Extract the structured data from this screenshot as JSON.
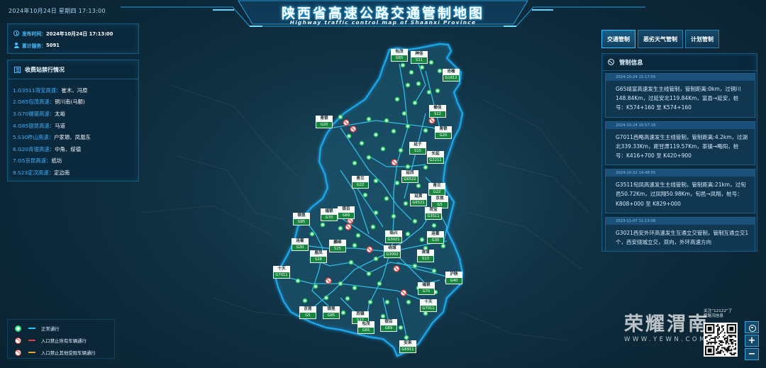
{
  "header": {
    "datetime": "2024年10月24日 星期四 17:13:00",
    "title": "陕西省高速公路交通管制地图",
    "subtitle": "Highway traffic control map of Shaanxi Province"
  },
  "info": {
    "publish_label": "发布时间：",
    "publish_value": "2024年10月24日 17:13:00",
    "service_label": "累计服务：",
    "service_value": "5091"
  },
  "stations": {
    "title": "收费站禁行情况",
    "items": [
      {
        "road": "1.G3511菏宝高速：",
        "stations": "崔木、冯原"
      },
      {
        "road": "2.G65包茂高速：",
        "stations": "铜川南(马额)"
      },
      {
        "road": "3.G70福银高速：",
        "stations": "太峪"
      },
      {
        "road": "4.G85银昆高速：",
        "stations": "马道"
      },
      {
        "road": "5.S30祚山高速：",
        "stations": "户家塬、凤凰东"
      },
      {
        "road": "6.G20青银高速：",
        "stations": "中角、绥德"
      },
      {
        "road": "7.G5京昆高速：",
        "stations": "纸坊"
      },
      {
        "road": "8.S23定汉高速：",
        "stations": "定边南"
      }
    ]
  },
  "tabs": [
    {
      "label": "交通管制"
    },
    {
      "label": "恶劣天气管制"
    },
    {
      "label": "计划管制"
    }
  ],
  "control_info": {
    "title": "管制信息",
    "cards": [
      {
        "time": "2024-10-24 15:17:55",
        "text": "G65靖富高速发生主线管制，管制距离:0km，过铜川148.84Km，过延安北119.84Km，富县→延安，桩号：K574+160 至 K574+160"
      },
      {
        "time": "2024-10-24 10:57:18",
        "text": "G7011西略高速发生主线管制，管制距离:4.2km，过湖北339.33Km，距甘肃119.57Km，茶镇→略阳，桩号：K416+700 至 K420+900"
      },
      {
        "time": "2024-10-22 14:48:55",
        "text": "G3511旬凤高速发生主线管制，管制距离:21km，过旬邑50.72Km，过凤翔50.98Km，旬邑→凤翔，桩号：K808+000 至 K829+000"
      },
      {
        "time": "2023-11-07 11:13:08",
        "text": "G3021西安外环高速发生互通立交管制，管制互通立交1个，西安绕城立交，双向，外环高速方向"
      }
    ]
  },
  "legend": [
    {
      "label": "正常通行"
    },
    {
      "label": "入口禁止所有车辆通行"
    },
    {
      "label": "入口禁止其他受限车辆通行"
    }
  ],
  "map": {
    "labels": [
      {
        "name": "包茂",
        "code": "G65"
      },
      {
        "name": "神佳",
        "code": "S11"
      },
      {
        "name": "沧榆",
        "code": "G1812"
      },
      {
        "name": "榆佳",
        "code": "S12"
      },
      {
        "name": "青银",
        "code": "G20"
      },
      {
        "name": "青银",
        "code": "G20"
      },
      {
        "name": "延子",
        "code": "S15"
      },
      {
        "name": "长延",
        "code": "G2211"
      },
      {
        "name": "延西",
        "code": "G6522"
      },
      {
        "name": "青兰",
        "code": "G22"
      },
      {
        "name": "青兰",
        "code": "G22"
      },
      {
        "name": "延黄",
        "code": "G6521"
      },
      {
        "name": "京昆",
        "code": "G5"
      },
      {
        "name": "菏宝",
        "code": "G3511"
      },
      {
        "name": "银昆",
        "code": "G85"
      },
      {
        "name": "福银",
        "code": "G70"
      },
      {
        "name": "银百",
        "code": "G69"
      },
      {
        "name": "临兴",
        "code": "G3021"
      },
      {
        "name": "连霍",
        "code": "G30"
      },
      {
        "name": "连霍",
        "code": "G30"
      },
      {
        "name": "麟绛",
        "code": "S25"
      },
      {
        "name": "眉凤",
        "code": "S28"
      },
      {
        "name": "绕城",
        "code": "G3002"
      },
      {
        "name": "渭蒲",
        "code": "S13"
      },
      {
        "name": "十天",
        "code": "G7011"
      },
      {
        "name": "沪陕",
        "code": "G40"
      },
      {
        "name": "福银",
        "code": "G70"
      },
      {
        "name": "十天",
        "code": "G7011"
      },
      {
        "name": "京昆",
        "code": "G5"
      },
      {
        "name": "银昆",
        "code": "G85"
      },
      {
        "name": "西镇",
        "code": "S27"
      },
      {
        "name": "包茂",
        "code": "G65"
      },
      {
        "name": "银百",
        "code": "G69"
      },
      {
        "name": "安来",
        "code": "G6911"
      }
    ]
  },
  "watermark": {
    "brand": "荣耀渭南",
    "url": "WWW.YEWN.COM",
    "qr_note_1": "关注“12122”了",
    "qr_note_2": "解路况信息"
  },
  "zoom": {
    "in": "+",
    "out": "−"
  },
  "colors": {
    "accent": "#1ec8ff",
    "normal": "#2ee07a",
    "closed_all": "#e23b3b",
    "closed_other": "#f0a030"
  }
}
